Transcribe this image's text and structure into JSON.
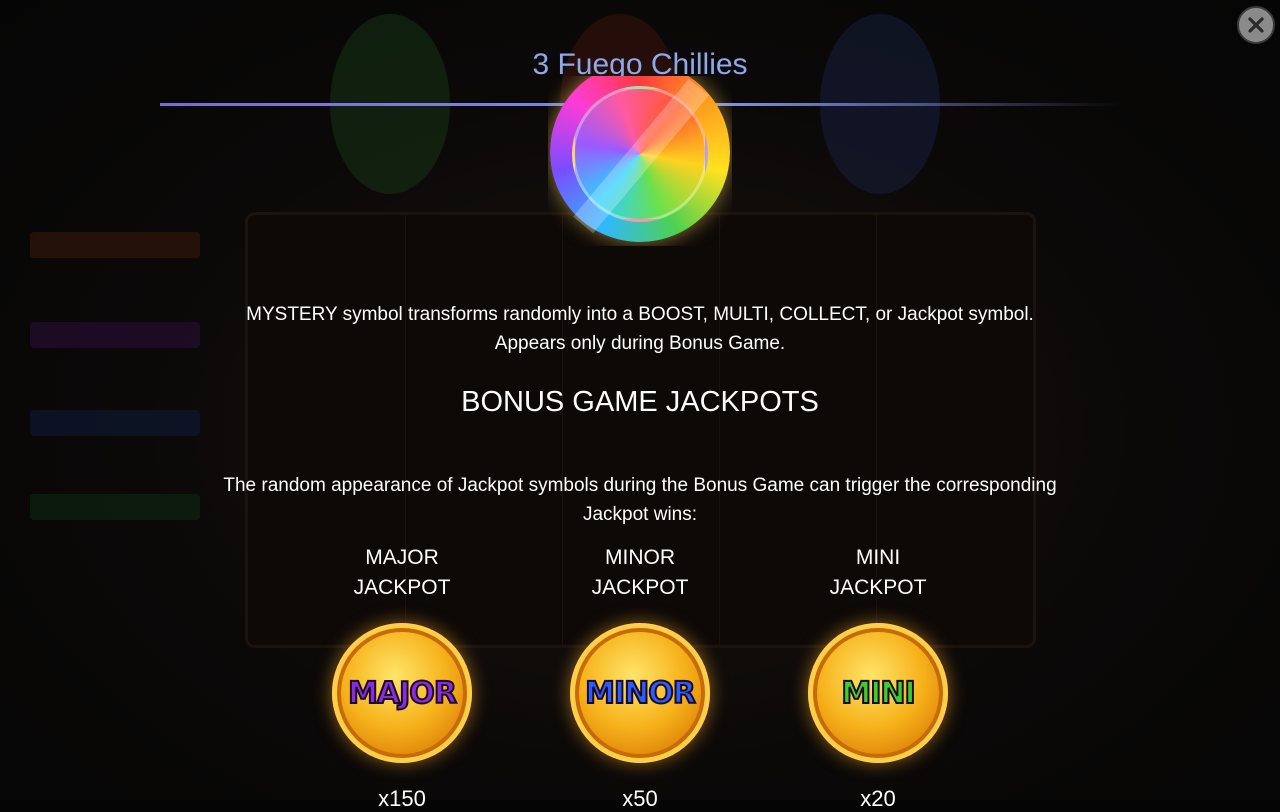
{
  "header": {
    "title": "3 Fuego Chillies"
  },
  "mystery": {
    "description_line1": "MYSTERY symbol transforms randomly into a BOOST, MULTI, COLLECT, or Jackpot symbol.",
    "description_line2": "Appears only during Bonus Game."
  },
  "bonus": {
    "heading": "BONUS GAME JACKPOTS",
    "text_line1": "The random appearance of Jackpot symbols during the Bonus Game can trigger the corresponding",
    "text_line2": "Jackpot wins:"
  },
  "jackpots": [
    {
      "label_line1": "MAJOR",
      "label_line2": "JACKPOT",
      "coin_text": "MAJOR",
      "coin_color": "#8a2be2",
      "multiplier": "x150"
    },
    {
      "label_line1": "MINOR",
      "label_line2": "JACKPOT",
      "coin_text": "MINOR",
      "coin_color": "#2a5cff",
      "multiplier": "x50"
    },
    {
      "label_line1": "MINI",
      "label_line2": "JACKPOT",
      "coin_text": "MINI",
      "coin_color": "#3ccf2a",
      "multiplier": "x20"
    }
  ],
  "icons": {
    "close": "close-icon",
    "mystery": "mystery-coin-icon",
    "jackpot": "jackpot-coin-icon"
  },
  "colors": {
    "title": "#8fa8e8",
    "accent_line": "#7a6ad8"
  }
}
